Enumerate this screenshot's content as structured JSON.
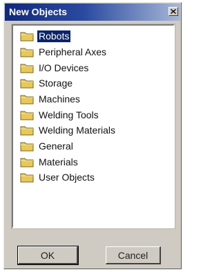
{
  "window": {
    "title": "New Objects"
  },
  "tree": {
    "items": [
      {
        "label": "Robots",
        "selected": true
      },
      {
        "label": "Peripheral Axes",
        "selected": false
      },
      {
        "label": "I/O Devices",
        "selected": false
      },
      {
        "label": "Storage",
        "selected": false
      },
      {
        "label": "Machines",
        "selected": false
      },
      {
        "label": "Welding Tools",
        "selected": false
      },
      {
        "label": "Welding Materials",
        "selected": false
      },
      {
        "label": "General",
        "selected": false
      },
      {
        "label": "Materials",
        "selected": false
      },
      {
        "label": "User Objects",
        "selected": false
      }
    ]
  },
  "buttons": {
    "ok": "OK",
    "cancel": "Cancel"
  },
  "icons": {
    "tree_item": "folder-icon",
    "close": "close-icon"
  },
  "colors": {
    "selection": "#0a246a",
    "folder": "#e8c858"
  }
}
